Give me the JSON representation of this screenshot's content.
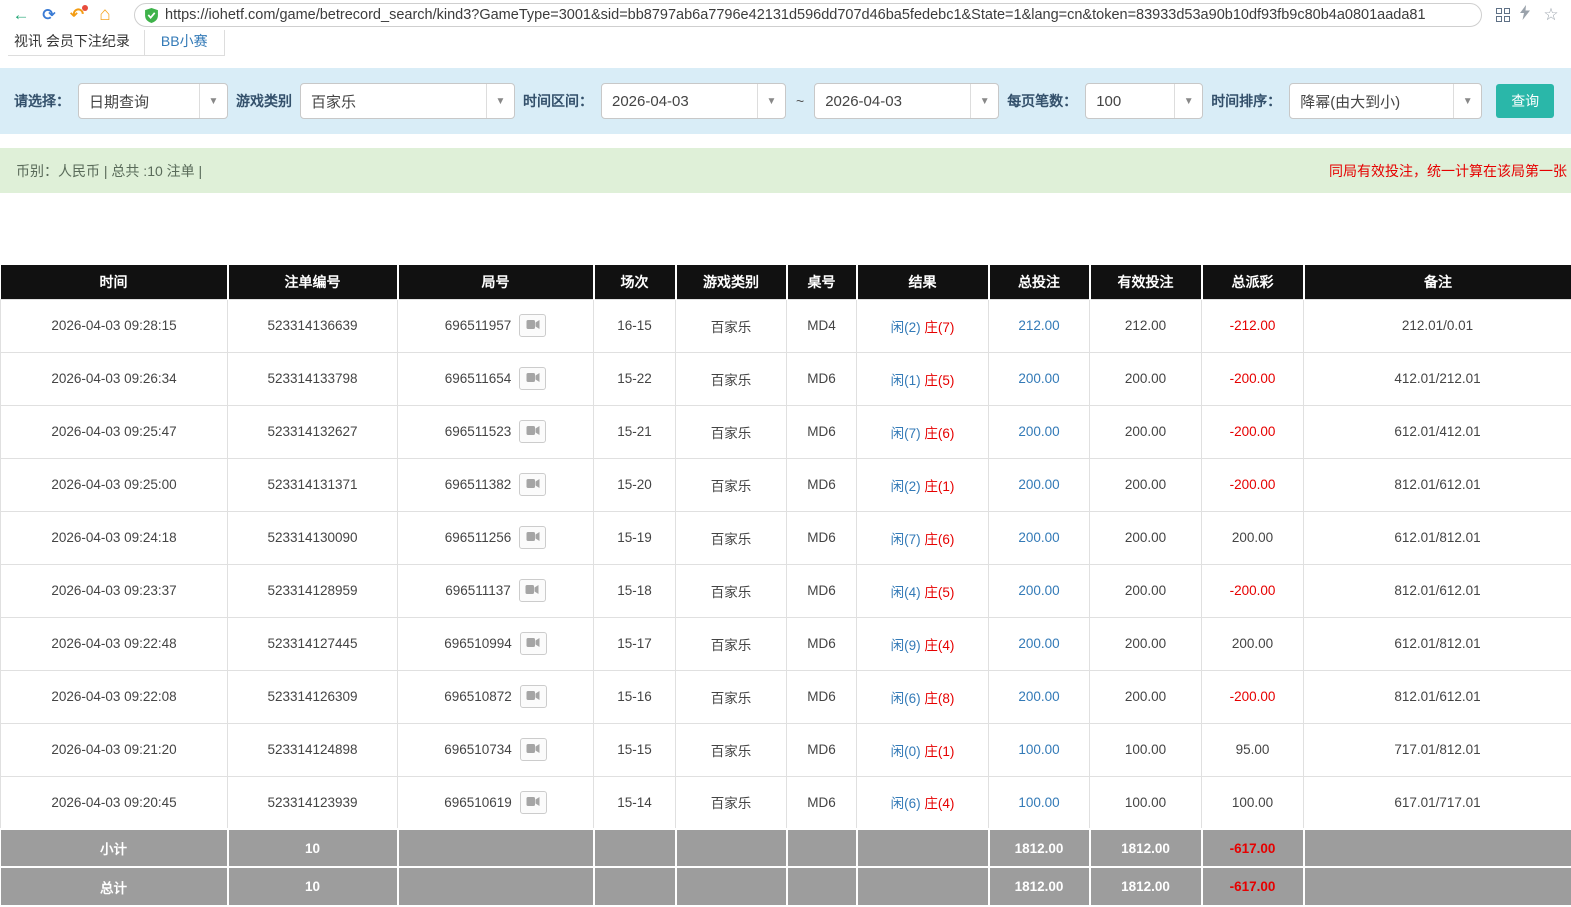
{
  "browser": {
    "url": "https://iohetf.com/game/betrecord_search/kind3?GameType=3001&sid=bb8797ab6a7796e42131d596dd707d46ba5fedebc1&State=1&lang=cn&token=83933d53a90b10df93fb9c80b4a0801aada81"
  },
  "tabs": {
    "record_tab": "视讯 会员下注纪录",
    "bb_tab": "BB小赛"
  },
  "filters": {
    "select_label": "请选择：",
    "query_type": "日期查询",
    "game_category_label": "游戏类别",
    "game_category": "百家乐",
    "time_range_label": "时间区间：",
    "date_from": "2026-04-03",
    "range_separator": "~",
    "date_to": "2026-04-03",
    "page_size_label": "每页笔数：",
    "page_size": "100",
    "sort_label": "时间排序：",
    "sort_order": "降幂(由大到小)",
    "search_button": "查询"
  },
  "info_bar": {
    "summary": "币别：人民币 | 总共 :10 注单 |",
    "notice": "同局有效投注，统一计算在该局第一张"
  },
  "table": {
    "headers": [
      "时间",
      "注单编号",
      "局号",
      "场次",
      "游戏类别",
      "桌号",
      "结果",
      "总投注",
      "有效投注",
      "总派彩",
      "备注"
    ],
    "rows": [
      {
        "time": "2026-04-03 09:28:15",
        "bet_id": "523314136639",
        "round": "696511957",
        "session": "16-15",
        "game": "百家乐",
        "table_no": "MD4",
        "result_player": "闲(2)",
        "result_banker": "庄(7)",
        "total_bet": "212.00",
        "valid_bet": "212.00",
        "payout": "-212.00",
        "remark": "212.01/0.01"
      },
      {
        "time": "2026-04-03 09:26:34",
        "bet_id": "523314133798",
        "round": "696511654",
        "session": "15-22",
        "game": "百家乐",
        "table_no": "MD6",
        "result_player": "闲(1)",
        "result_banker": "庄(5)",
        "total_bet": "200.00",
        "valid_bet": "200.00",
        "payout": "-200.00",
        "remark": "412.01/212.01"
      },
      {
        "time": "2026-04-03 09:25:47",
        "bet_id": "523314132627",
        "round": "696511523",
        "session": "15-21",
        "game": "百家乐",
        "table_no": "MD6",
        "result_player": "闲(7)",
        "result_banker": "庄(6)",
        "total_bet": "200.00",
        "valid_bet": "200.00",
        "payout": "-200.00",
        "remark": "612.01/412.01"
      },
      {
        "time": "2026-04-03 09:25:00",
        "bet_id": "523314131371",
        "round": "696511382",
        "session": "15-20",
        "game": "百家乐",
        "table_no": "MD6",
        "result_player": "闲(2)",
        "result_banker": "庄(1)",
        "total_bet": "200.00",
        "valid_bet": "200.00",
        "payout": "-200.00",
        "remark": "812.01/612.01"
      },
      {
        "time": "2026-04-03 09:24:18",
        "bet_id": "523314130090",
        "round": "696511256",
        "session": "15-19",
        "game": "百家乐",
        "table_no": "MD6",
        "result_player": "闲(7)",
        "result_banker": "庄(6)",
        "total_bet": "200.00",
        "valid_bet": "200.00",
        "payout": "200.00",
        "remark": "612.01/812.01"
      },
      {
        "time": "2026-04-03 09:23:37",
        "bet_id": "523314128959",
        "round": "696511137",
        "session": "15-18",
        "game": "百家乐",
        "table_no": "MD6",
        "result_player": "闲(4)",
        "result_banker": "庄(5)",
        "total_bet": "200.00",
        "valid_bet": "200.00",
        "payout": "-200.00",
        "remark": "812.01/612.01"
      },
      {
        "time": "2026-04-03 09:22:48",
        "bet_id": "523314127445",
        "round": "696510994",
        "session": "15-17",
        "game": "百家乐",
        "table_no": "MD6",
        "result_player": "闲(9)",
        "result_banker": "庄(4)",
        "total_bet": "200.00",
        "valid_bet": "200.00",
        "payout": "200.00",
        "remark": "612.01/812.01"
      },
      {
        "time": "2026-04-03 09:22:08",
        "bet_id": "523314126309",
        "round": "696510872",
        "session": "15-16",
        "game": "百家乐",
        "table_no": "MD6",
        "result_player": "闲(6)",
        "result_banker": "庄(8)",
        "total_bet": "200.00",
        "valid_bet": "200.00",
        "payout": "-200.00",
        "remark": "812.01/612.01"
      },
      {
        "time": "2026-04-03 09:21:20",
        "bet_id": "523314124898",
        "round": "696510734",
        "session": "15-15",
        "game": "百家乐",
        "table_no": "MD6",
        "result_player": "闲(0)",
        "result_banker": "庄(1)",
        "total_bet": "100.00",
        "valid_bet": "100.00",
        "payout": "95.00",
        "remark": "717.01/812.01"
      },
      {
        "time": "2026-04-03 09:20:45",
        "bet_id": "523314123939",
        "round": "696510619",
        "session": "15-14",
        "game": "百家乐",
        "table_no": "MD6",
        "result_player": "闲(6)",
        "result_banker": "庄(4)",
        "total_bet": "100.00",
        "valid_bet": "100.00",
        "payout": "100.00",
        "remark": "617.01/717.01"
      }
    ],
    "footer": [
      {
        "label": "小计",
        "count": "10",
        "total_bet": "1812.00",
        "valid_bet": "1812.00",
        "payout": "-617.00"
      },
      {
        "label": "总计",
        "count": "10",
        "total_bet": "1812.00",
        "valid_bet": "1812.00",
        "payout": "-617.00"
      }
    ]
  },
  "colors": {
    "accent_teal": "#2ab7a9",
    "link_blue": "#337ab7",
    "negative_red": "#e60000",
    "header_black": "#111111",
    "footer_gray": "#9d9d9d",
    "filter_bg": "#d9edf7",
    "info_bg": "#dff0d8"
  }
}
